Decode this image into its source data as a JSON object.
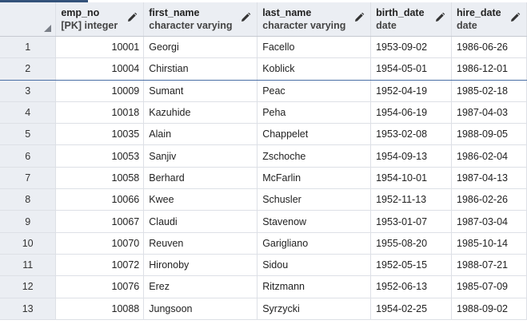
{
  "columns": [
    {
      "name": "",
      "type": ""
    },
    {
      "name": "emp_no",
      "type": "[PK] integer"
    },
    {
      "name": "first_name",
      "type": "character varying"
    },
    {
      "name": "last_name",
      "type": "character varying"
    },
    {
      "name": "birth_date",
      "type": "date"
    },
    {
      "name": "hire_date",
      "type": "date"
    }
  ],
  "rows": [
    {
      "n": "1",
      "emp_no": "10001",
      "first_name": "Georgi",
      "last_name": "Facello",
      "birth_date": "1953-09-02",
      "hire_date": "1986-06-26"
    },
    {
      "n": "2",
      "emp_no": "10004",
      "first_name": "Chirstian",
      "last_name": "Koblick",
      "birth_date": "1954-05-01",
      "hire_date": "1986-12-01"
    },
    {
      "n": "3",
      "emp_no": "10009",
      "first_name": "Sumant",
      "last_name": "Peac",
      "birth_date": "1952-04-19",
      "hire_date": "1985-02-18"
    },
    {
      "n": "4",
      "emp_no": "10018",
      "first_name": "Kazuhide",
      "last_name": "Peha",
      "birth_date": "1954-06-19",
      "hire_date": "1987-04-03"
    },
    {
      "n": "5",
      "emp_no": "10035",
      "first_name": "Alain",
      "last_name": "Chappelet",
      "birth_date": "1953-02-08",
      "hire_date": "1988-09-05"
    },
    {
      "n": "6",
      "emp_no": "10053",
      "first_name": "Sanjiv",
      "last_name": "Zschoche",
      "birth_date": "1954-09-13",
      "hire_date": "1986-02-04"
    },
    {
      "n": "7",
      "emp_no": "10058",
      "first_name": "Berhard",
      "last_name": "McFarlin",
      "birth_date": "1954-10-01",
      "hire_date": "1987-04-13"
    },
    {
      "n": "8",
      "emp_no": "10066",
      "first_name": "Kwee",
      "last_name": "Schusler",
      "birth_date": "1952-11-13",
      "hire_date": "1986-02-26"
    },
    {
      "n": "9",
      "emp_no": "10067",
      "first_name": "Claudi",
      "last_name": "Stavenow",
      "birth_date": "1953-01-07",
      "hire_date": "1987-03-04"
    },
    {
      "n": "10",
      "emp_no": "10070",
      "first_name": "Reuven",
      "last_name": "Garigliano",
      "birth_date": "1955-08-20",
      "hire_date": "1985-10-14"
    },
    {
      "n": "11",
      "emp_no": "10072",
      "first_name": "Hironoby",
      "last_name": "Sidou",
      "birth_date": "1952-05-15",
      "hire_date": "1988-07-21"
    },
    {
      "n": "12",
      "emp_no": "10076",
      "first_name": "Erez",
      "last_name": "Ritzmann",
      "birth_date": "1952-06-13",
      "hire_date": "1985-07-09"
    },
    {
      "n": "13",
      "emp_no": "10088",
      "first_name": "Jungsoon",
      "last_name": "Syrzycki",
      "birth_date": "1954-02-25",
      "hire_date": "1988-09-02"
    }
  ],
  "selected_row": 1,
  "icons": {
    "edit": "pencil-icon",
    "sort_corner": "select-all-corner-icon"
  },
  "colors": {
    "header_bg": "#ebeef3",
    "grid_line": "#dde0e6",
    "accent": "#33527a",
    "selection_line": "#4a6fa5"
  }
}
